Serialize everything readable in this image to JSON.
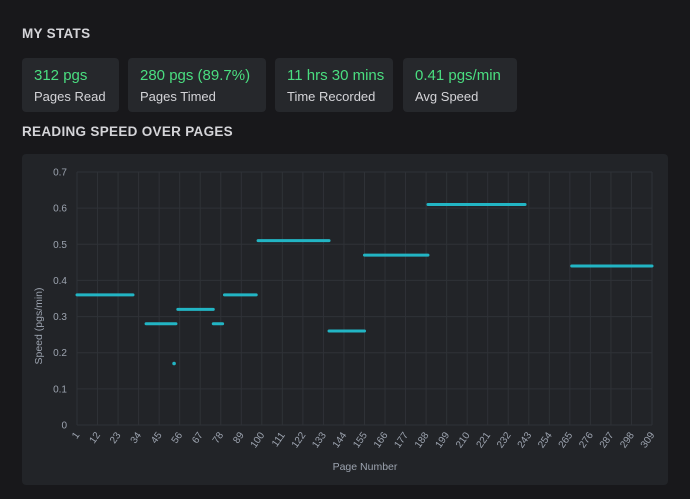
{
  "stats": {
    "title": "MY STATS",
    "cards": [
      {
        "value": "312 pgs",
        "label": "Pages Read"
      },
      {
        "value": "280 pgs (89.7%)",
        "label": "Pages Timed"
      },
      {
        "value": "11 hrs 30 mins",
        "label": "Time Recorded"
      },
      {
        "value": "0.41 pgs/min",
        "label": "Avg Speed"
      }
    ]
  },
  "speed_section": {
    "title": "READING SPEED OVER PAGES"
  },
  "colors": {
    "accent_green": "#4ade80",
    "series": "#22b5c4",
    "background": "#18181b",
    "panel": "#222428",
    "card": "#26282c"
  },
  "chart_data": {
    "type": "line",
    "title": "READING SPEED OVER PAGES",
    "xlabel": "Page Number",
    "ylabel": "Speed (pgs/min)",
    "xlim": [
      1,
      309
    ],
    "ylim": [
      0,
      0.7
    ],
    "x_ticks": [
      "1",
      "12",
      "23",
      "34",
      "45",
      "56",
      "67",
      "78",
      "89",
      "100",
      "111",
      "122",
      "133",
      "144",
      "155",
      "166",
      "177",
      "188",
      "199",
      "210",
      "221",
      "232",
      "243",
      "254",
      "265",
      "276",
      "287",
      "298",
      "309"
    ],
    "y_ticks": [
      "0",
      "0.1",
      "0.2",
      "0.3",
      "0.4",
      "0.5",
      "0.6",
      "0.7"
    ],
    "grid": true,
    "series": [
      {
        "segments": [
          {
            "x": [
              1,
              31
            ],
            "y": 0.36
          },
          {
            "x": [
              38,
              54
            ],
            "y": 0.28
          },
          {
            "x": [
              53,
              53
            ],
            "y": 0.17
          },
          {
            "x": [
              55,
              74
            ],
            "y": 0.32
          },
          {
            "x": [
              74,
              79
            ],
            "y": 0.28
          },
          {
            "x": [
              80,
              97
            ],
            "y": 0.36
          },
          {
            "x": [
              98,
              136
            ],
            "y": 0.51
          },
          {
            "x": [
              136,
              155
            ],
            "y": 0.26
          },
          {
            "x": [
              155,
              189
            ],
            "y": 0.47
          },
          {
            "x": [
              189,
              241
            ],
            "y": 0.61
          },
          {
            "x": [
              266,
              309
            ],
            "y": 0.44
          }
        ]
      }
    ]
  }
}
